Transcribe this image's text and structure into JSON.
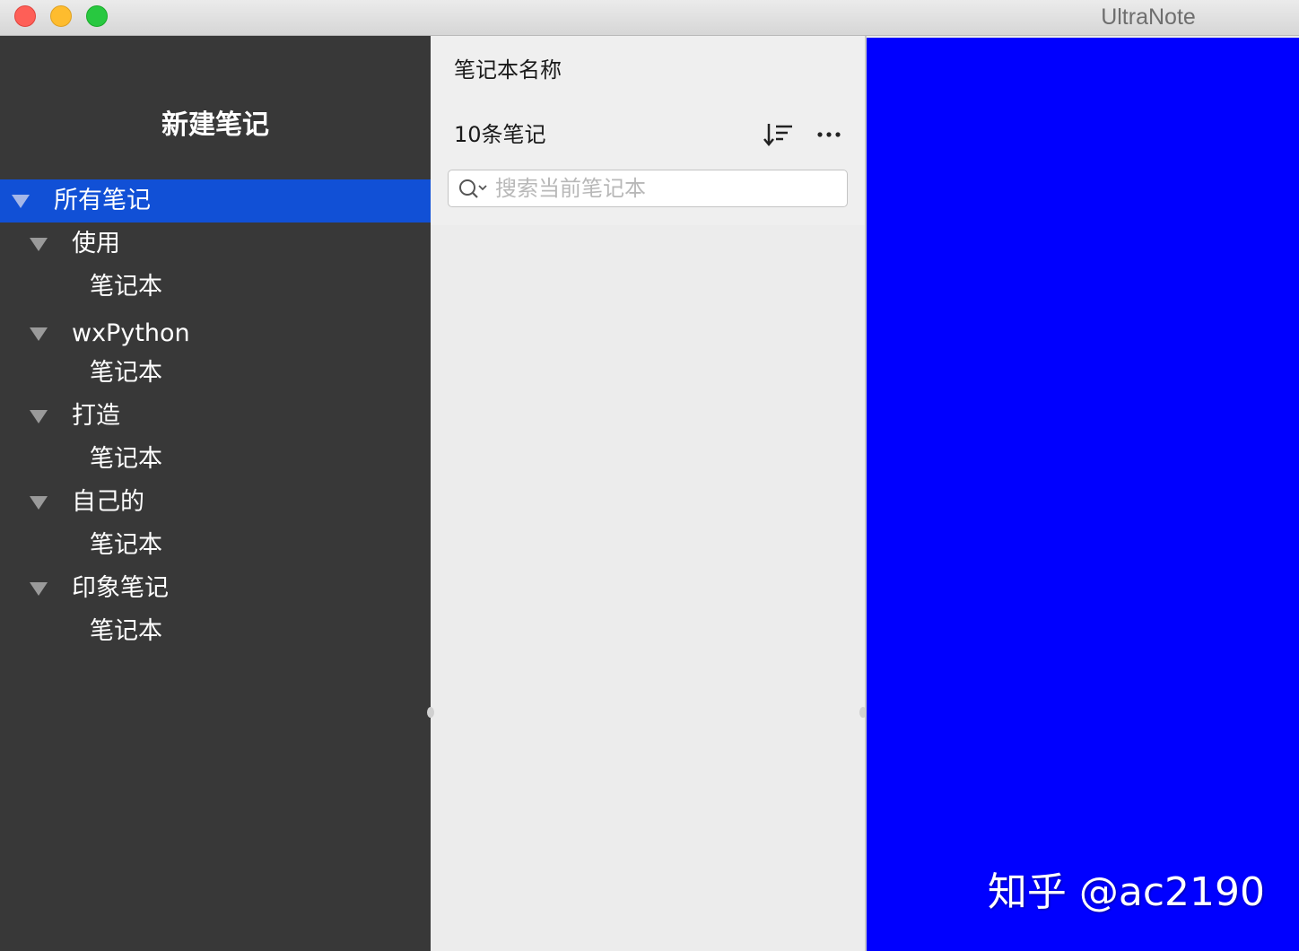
{
  "window": {
    "title": "UltraNote"
  },
  "sidebar": {
    "new_note_label": "新建笔记",
    "tree": [
      {
        "label": "所有笔记",
        "selected": true,
        "expanded": true
      },
      {
        "label": "使用",
        "expanded": true
      },
      {
        "label": "笔记本"
      },
      {
        "label": "wxPython",
        "expanded": true
      },
      {
        "label": "笔记本"
      },
      {
        "label": "打造",
        "expanded": true
      },
      {
        "label": "笔记本"
      },
      {
        "label": "自己的",
        "expanded": true
      },
      {
        "label": "笔记本"
      },
      {
        "label": "印象笔记",
        "expanded": true
      },
      {
        "label": "笔记本"
      }
    ]
  },
  "note_list": {
    "notebook_name": "笔记本名称",
    "note_count": "10条笔记",
    "search": {
      "placeholder": "搜索当前笔记本",
      "value": ""
    }
  },
  "editor": {
    "watermark": "知乎 @ac2190"
  },
  "colors": {
    "sidebar_bg": "#383838",
    "selection": "#1150d6",
    "editor_bg": "#0000ff"
  },
  "icons": {
    "sort": "sort-descending-icon",
    "more": "more-horizontal-icon",
    "search": "search-icon"
  }
}
